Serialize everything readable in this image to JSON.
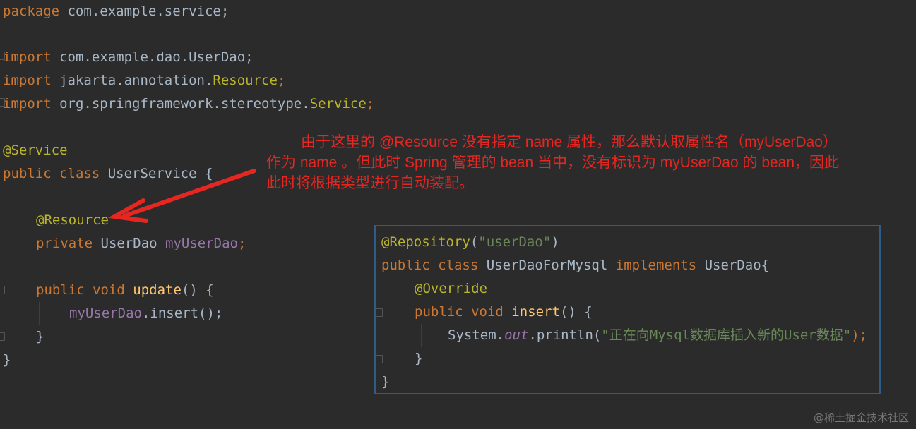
{
  "editor": {
    "lines": {
      "package_kw": "package",
      "package_name": " com.example.service;",
      "import1_kw": "import",
      "import1_name": " com.example.dao.UserDao;",
      "import2_kw": "import",
      "import2_pkg": " jakarta.annotation.",
      "import2_cls": "Resource",
      "import2_end": ";",
      "import3_kw": "import",
      "import3_pkg": " org.springframework.stereotype.",
      "import3_cls": "Service",
      "import3_end": ";",
      "ann_service": "@Service",
      "class_decl_kw": "public class",
      "class_decl_rest": " UserService {",
      "ann_resource": "@Resource",
      "field_kw": "private",
      "field_type": " UserDao ",
      "field_name": "myUserDao",
      "field_end": ";",
      "method_kw": "public void",
      "method_name": "update",
      "method_rest": "() {",
      "call_obj": "myUserDao",
      "call_rest": ".insert();",
      "close_method": "}",
      "close_class": "}"
    }
  },
  "popup": {
    "ann_repo": "@Repository",
    "ann_repo_open": "(",
    "ann_repo_str": "\"userDao\"",
    "ann_repo_close": ")",
    "class_kw": "public class",
    "class_name": " UserDaoForMysql ",
    "impl_kw": "implements",
    "impl_rest": " UserDao{",
    "override": "@Override",
    "method_kw": "public void",
    "method_name": "insert",
    "method_rest": "() {",
    "print_obj": "System.",
    "print_out": "out",
    "print_call": ".println(",
    "print_str": "\"正在向Mysql数据库插入新的User数据\"",
    "print_end": ");",
    "close_method": "}",
    "close_class": "}"
  },
  "annotation": {
    "line1": "由于这里的 @Resource 没有指定 name 属性，那么默认取属性名（myUserDao）",
    "line2": "作为 name 。但此时 Spring 管理的 bean 当中，没有标识为 myUserDao 的 bean，因此",
    "line3": "此时将根据类型进行自动装配。",
    "color": "#e52621"
  },
  "watermark": "@稀土掘金技术社区",
  "colors": {
    "background": "#2b2b2b",
    "keyword": "#cc7832",
    "annotation": "#bbb529",
    "field": "#9876aa",
    "method": "#ffc66d",
    "string": "#6a8759",
    "popup_border": "#2f5d8a"
  }
}
